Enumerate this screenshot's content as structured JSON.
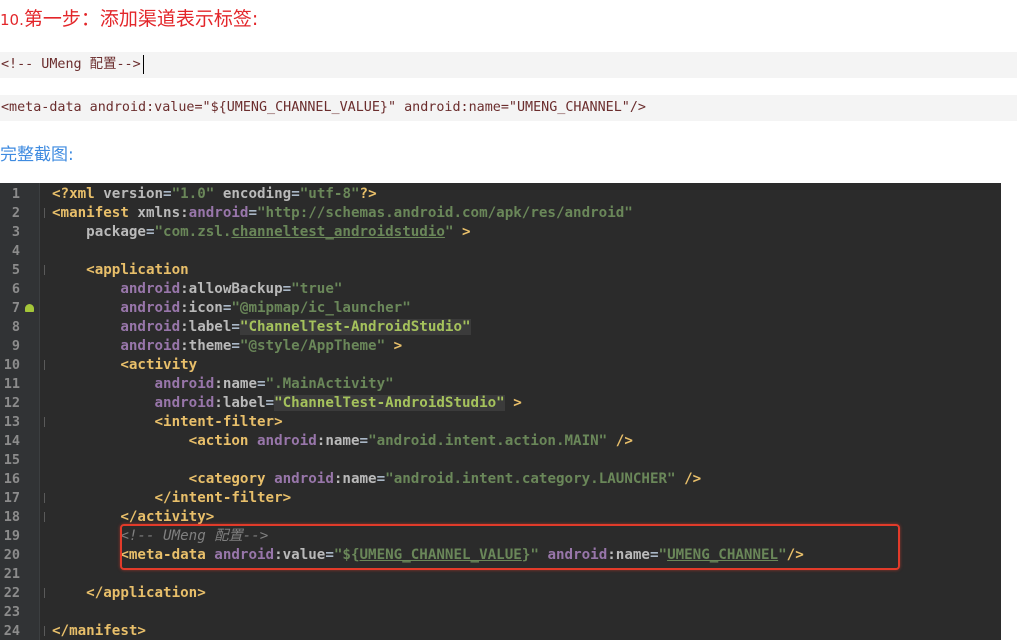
{
  "heading": {
    "step_number": "10.",
    "text": "第一步：添加渠道表示标签:"
  },
  "snippet1": "<!-- UMeng 配置-->",
  "snippet2": "<meta-data android:value=\"${UMENG_CHANNEL_VALUE}\" android:name=\"UMENG_CHANNEL\"/>",
  "caption": "完整截图:",
  "colors": {
    "heading": "#e3262a",
    "caption": "#3f8be0",
    "ide_background": "#2b2b2b",
    "highlight_border": "#e23b2a"
  },
  "ide": {
    "lines": [
      {
        "n": "1",
        "parts": [
          [
            "t-tag",
            "<?xml "
          ],
          [
            "t-attr",
            "version"
          ],
          [
            "t-plain",
            "="
          ],
          [
            "t-val",
            "\"1.0\""
          ],
          [
            "t-attr",
            " encoding"
          ],
          [
            "t-plain",
            "="
          ],
          [
            "t-val",
            "\"utf-8\""
          ],
          [
            "t-tag",
            "?>"
          ]
        ]
      },
      {
        "n": "2",
        "parts": [
          [
            "t-tag",
            "<manifest "
          ],
          [
            "t-attr",
            "xmlns:"
          ],
          [
            "t-ns",
            "android"
          ],
          [
            "t-plain",
            "="
          ],
          [
            "t-val",
            "\"http://schemas.android.com/apk/res/android\""
          ]
        ]
      },
      {
        "n": "3",
        "parts": [
          [
            "t-attr",
            "    package"
          ],
          [
            "t-plain",
            "="
          ],
          [
            "t-val",
            "\"com.zsl."
          ],
          [
            "t-val t-u",
            "channeltest_androidstudio"
          ],
          [
            "t-val",
            "\""
          ],
          [
            "t-tag",
            " >"
          ]
        ]
      },
      {
        "n": "4",
        "parts": []
      },
      {
        "n": "5",
        "parts": [
          [
            "t-tag",
            "    <application"
          ]
        ]
      },
      {
        "n": "6",
        "parts": [
          [
            "t-ns",
            "        android"
          ],
          [
            "t-attr",
            ":allowBackup"
          ],
          [
            "t-plain",
            "="
          ],
          [
            "t-val",
            "\"true\""
          ]
        ]
      },
      {
        "n": "7",
        "parts": [
          [
            "t-ns",
            "        android"
          ],
          [
            "t-attr",
            ":icon"
          ],
          [
            "t-plain",
            "="
          ],
          [
            "t-val",
            "\"@mipmap/ic_launcher\""
          ]
        ]
      },
      {
        "n": "8",
        "parts": [
          [
            "t-ns",
            "        android"
          ],
          [
            "t-attr",
            ":label"
          ],
          [
            "t-plain",
            "="
          ],
          [
            "t-valg t-hl",
            "\"ChannelTest-AndroidStudio\""
          ]
        ]
      },
      {
        "n": "9",
        "parts": [
          [
            "t-ns",
            "        android"
          ],
          [
            "t-attr",
            ":theme"
          ],
          [
            "t-plain",
            "="
          ],
          [
            "t-val",
            "\"@style/AppTheme\""
          ],
          [
            "t-tag",
            " >"
          ]
        ]
      },
      {
        "n": "10",
        "parts": [
          [
            "t-tag",
            "        <activity"
          ]
        ]
      },
      {
        "n": "11",
        "parts": [
          [
            "t-ns",
            "            android"
          ],
          [
            "t-attr",
            ":name"
          ],
          [
            "t-plain",
            "="
          ],
          [
            "t-val",
            "\".MainActivity\""
          ]
        ]
      },
      {
        "n": "12",
        "parts": [
          [
            "t-ns",
            "            android"
          ],
          [
            "t-attr",
            ":label"
          ],
          [
            "t-plain",
            "="
          ],
          [
            "t-valg t-hl",
            "\"ChannelTest-AndroidStudio\""
          ],
          [
            "t-tag",
            " >"
          ]
        ]
      },
      {
        "n": "13",
        "parts": [
          [
            "t-tag",
            "            <intent-filter>"
          ]
        ]
      },
      {
        "n": "14",
        "parts": [
          [
            "t-tag",
            "                <action "
          ],
          [
            "t-ns",
            "android"
          ],
          [
            "t-attr",
            ":name"
          ],
          [
            "t-plain",
            "="
          ],
          [
            "t-val",
            "\"android.intent.action.MAIN\""
          ],
          [
            "t-tag",
            " />"
          ]
        ]
      },
      {
        "n": "15",
        "parts": []
      },
      {
        "n": "16",
        "parts": [
          [
            "t-tag",
            "                <category "
          ],
          [
            "t-ns",
            "android"
          ],
          [
            "t-attr",
            ":name"
          ],
          [
            "t-plain",
            "="
          ],
          [
            "t-val",
            "\"android.intent.category.LAUNCHER\""
          ],
          [
            "t-tag",
            " />"
          ]
        ]
      },
      {
        "n": "17",
        "parts": [
          [
            "t-tag",
            "            </intent-filter>"
          ]
        ]
      },
      {
        "n": "18",
        "parts": [
          [
            "t-tag",
            "        </activity>"
          ]
        ]
      },
      {
        "n": "19",
        "parts": [
          [
            "t-com",
            "        <!-- UMeng 配置-->"
          ]
        ]
      },
      {
        "n": "20",
        "parts": [
          [
            "t-tag",
            "        <meta-data "
          ],
          [
            "t-ns",
            "android"
          ],
          [
            "t-attr",
            ":value"
          ],
          [
            "t-plain",
            "="
          ],
          [
            "t-val",
            "\"${"
          ],
          [
            "t-val t-u",
            "UMENG_CHANNEL_VALUE"
          ],
          [
            "t-val",
            "}\""
          ],
          [
            "t-ns",
            " android"
          ],
          [
            "t-attr",
            ":name"
          ],
          [
            "t-plain",
            "="
          ],
          [
            "t-val",
            "\""
          ],
          [
            "t-val t-u",
            "UMENG_CHANNEL"
          ],
          [
            "t-val",
            "\""
          ],
          [
            "t-tag",
            "/>"
          ]
        ]
      },
      {
        "n": "21",
        "parts": []
      },
      {
        "n": "22",
        "parts": [
          [
            "t-tag",
            "    </application>"
          ]
        ]
      },
      {
        "n": "23",
        "parts": []
      },
      {
        "n": "24",
        "parts": [
          [
            "t-tag",
            "</manifest>"
          ]
        ]
      }
    ]
  }
}
